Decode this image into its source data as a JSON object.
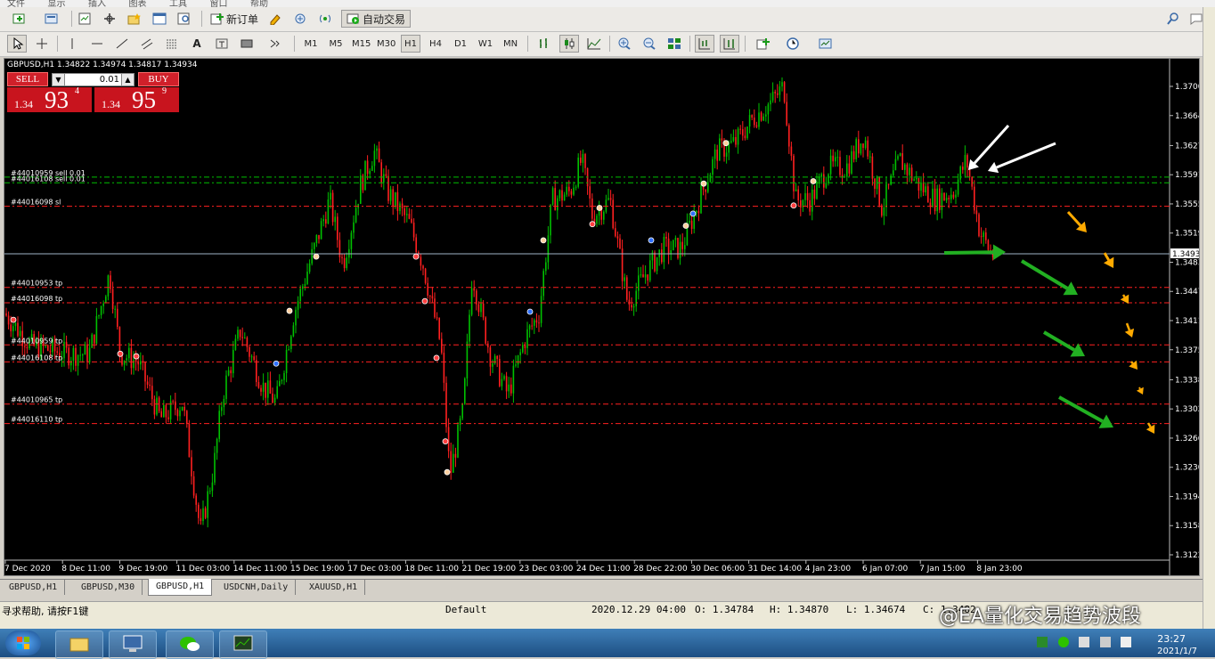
{
  "menu": [
    "文件",
    "显示",
    "插入",
    "图表",
    "工具",
    "窗口",
    "帮助"
  ],
  "toolbar": {
    "new_order": "新订单",
    "auto_trading": "自动交易",
    "timeframes": [
      "M1",
      "M5",
      "M15",
      "M30",
      "H1",
      "H4",
      "D1",
      "W1",
      "MN"
    ],
    "active_timeframe": "H1"
  },
  "chart": {
    "title": "GBPUSD,H1  1.34822 1.34974 1.34817 1.34934",
    "symbol": "GBPUSD",
    "period": "H1",
    "ohlc": {
      "open": "1.34822",
      "high": "1.34974",
      "low": "1.34817",
      "close": "1.34934"
    },
    "current_price_label": "1.3493",
    "price_axis": [
      "1.3700",
      "1.3664",
      "1.3627",
      "1.3591",
      "1.3555",
      "1.3519",
      "1.3483",
      "1.3447",
      "1.3411",
      "1.3375",
      "1.3338",
      "1.3302",
      "1.3266",
      "1.3230",
      "1.3194",
      "1.3158",
      "1.3122"
    ],
    "time_axis": [
      "7 Dec 2020",
      "8 Dec 11:00",
      "9 Dec 19:00",
      "11 Dec 03:00",
      "14 Dec 11:00",
      "15 Dec 19:00",
      "17 Dec 03:00",
      "18 Dec 11:00",
      "21 Dec 19:00",
      "23 Dec 03:00",
      "24 Dec 11:00",
      "28 Dec 22:00",
      "30 Dec 06:00",
      "31 Dec 14:00",
      "4 Jan 23:00",
      "6 Jan 07:00",
      "7 Jan 15:00",
      "8 Jan 23:00"
    ],
    "order_labels": [
      {
        "text": "#44010959 sell 0.01",
        "price": 1.3588,
        "color": "#00c000"
      },
      {
        "text": "#44016108 sell 0.01",
        "price": 1.3581,
        "color": "#00c000"
      },
      {
        "text": "#44016098 sl",
        "price": 1.3552,
        "color": "#ff2020"
      },
      {
        "text": "#44010953 tp",
        "price": 1.3452,
        "color": "#ff2020"
      },
      {
        "text": "#44016098 tp",
        "price": 1.3433,
        "color": "#ff2020"
      },
      {
        "text": "#44010959 tp",
        "price": 1.3381,
        "color": "#ff2020"
      },
      {
        "text": "#44016108 tp",
        "price": 1.336,
        "color": "#ff2020"
      },
      {
        "text": "#44010965 tp",
        "price": 1.3308,
        "color": "#ff2020"
      },
      {
        "text": "#44016110 tp",
        "price": 1.3284,
        "color": "#ff2020"
      }
    ]
  },
  "one_click": {
    "sell_label": "SELL",
    "buy_label": "BUY",
    "lot": "0.01",
    "sell_price_small": "1.34",
    "sell_price_big": "93",
    "sell_price_sup": "4",
    "buy_price_small": "1.34",
    "buy_price_big": "95",
    "buy_price_sup": "9"
  },
  "tabs": [
    "GBPUSD,H1",
    "GBPUSD,M30",
    "GBPUSD,H1",
    "USDCNH,Daily",
    "XAUUSD,H1"
  ],
  "active_tab_index": 2,
  "status": {
    "help": "寻求帮助, 请按F1键",
    "profile": "Default",
    "time": "2020.12.29 04:00",
    "open": "O: 1.34784",
    "high": "H: 1.34870",
    "low": "L: 1.34674",
    "close": "C: 1.3482"
  },
  "watermark": "@EA量化交易趋势波段",
  "taskbar": {
    "time": "23:27",
    "date": "2021/1/7"
  },
  "colors": {
    "bull": "#00c000",
    "bear": "#ff2020",
    "bg": "#000000",
    "arrow_white": "#ffffff",
    "arrow_green": "#22b022",
    "arrow_orange": "#ffaa00"
  }
}
